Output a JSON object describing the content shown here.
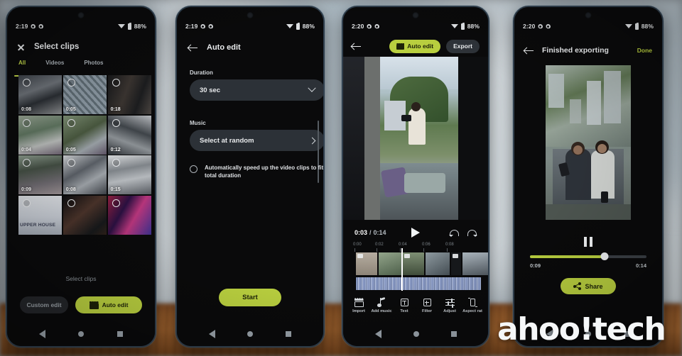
{
  "watermark": "ahoo!tech",
  "phones": [
    {
      "id": "phone-select-clips",
      "status": {
        "time": "2:19",
        "battery": "88%"
      },
      "title": "Select clips",
      "tabs": [
        {
          "label": "All",
          "active": true
        },
        {
          "label": "Videos",
          "active": false
        },
        {
          "label": "Photos",
          "active": false
        }
      ],
      "grid": [
        [
          {
            "duration": "0:08"
          },
          {
            "duration": "0:05"
          },
          {
            "duration": "0:18"
          }
        ],
        [
          {
            "duration": "0:04"
          },
          {
            "duration": "0:05"
          },
          {
            "duration": "0:12"
          }
        ],
        [
          {
            "duration": "0:09"
          },
          {
            "duration": "0:08"
          },
          {
            "duration": "0:15"
          }
        ],
        [
          {
            "duration": ""
          },
          {
            "duration": ""
          },
          {
            "duration": ""
          }
        ]
      ],
      "thumb_label": "UPPER HOUSE",
      "hint": "Select clips",
      "buttons": {
        "custom": "Custom edit",
        "auto": "Auto edit"
      }
    },
    {
      "id": "phone-auto-edit",
      "status": {
        "time": "2:19",
        "battery": "88%"
      },
      "title": "Auto edit",
      "duration_label": "Duration",
      "duration_value": "30 sec",
      "music_label": "Music",
      "music_value": "Select at random",
      "speedup_text": "Automatically speed up the video clips to fit total duration",
      "start_label": "Start"
    },
    {
      "id": "phone-editor",
      "status": {
        "time": "2:20",
        "battery": "88%"
      },
      "auto_edit_label": "Auto edit",
      "export_label": "Export",
      "time_current": "0:03",
      "time_sep": "/",
      "time_total": "0:14",
      "ruler": [
        "0:00",
        "0:02",
        "0:04",
        "0:06",
        "0:08"
      ],
      "toolbar": [
        {
          "label": "Import",
          "icon": "clapperboard-icon"
        },
        {
          "label": "Add music",
          "icon": "music-note-icon"
        },
        {
          "label": "Text",
          "icon": "text-box-icon"
        },
        {
          "label": "Filter",
          "icon": "filter-icon"
        },
        {
          "label": "Adjust",
          "icon": "sliders-icon"
        },
        {
          "label": "Aspect rat",
          "icon": "aspect-ratio-icon"
        }
      ]
    },
    {
      "id": "phone-finished",
      "status": {
        "time": "2:20",
        "battery": "88%"
      },
      "title": "Finished exporting",
      "done_label": "Done",
      "time_elapsed": "0:09",
      "time_total": "0:14",
      "progress_percent": 64,
      "share_label": "Share"
    }
  ],
  "colors": {
    "accent": "#b9cf3f",
    "panel": "#2c3137",
    "screen": "#0a0a0b"
  }
}
